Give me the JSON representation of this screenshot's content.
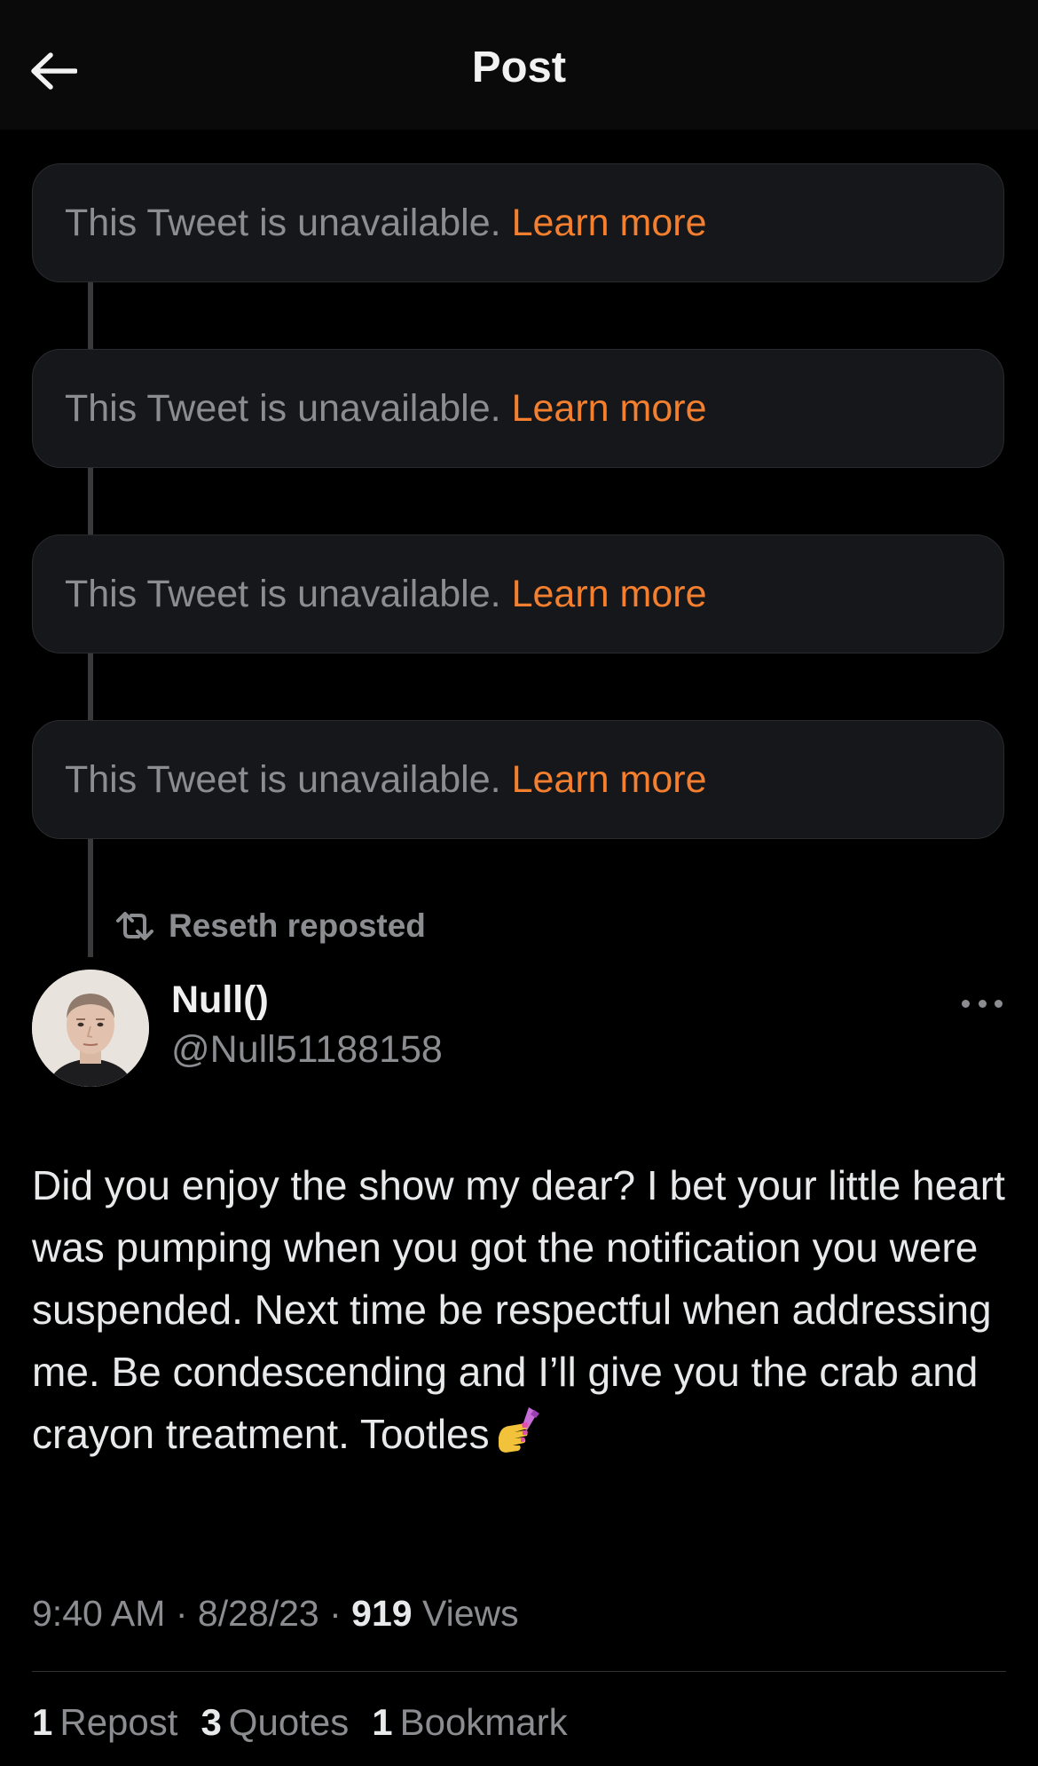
{
  "header": {
    "title": "Post",
    "back_icon": "arrow-left-icon"
  },
  "unavailable_tweets": [
    {
      "message": "This Tweet is unavailable.",
      "link": "Learn more"
    },
    {
      "message": "This Tweet is unavailable.",
      "link": "Learn more"
    },
    {
      "message": "This Tweet is unavailable.",
      "link": "Learn more"
    },
    {
      "message": "This Tweet is unavailable.",
      "link": "Learn more"
    }
  ],
  "repost_banner": {
    "icon": "repost-icon",
    "text": "Reseth reposted"
  },
  "tweet": {
    "author": {
      "display_name": "Null()",
      "handle": "@Null51188158"
    },
    "text": "Did you enjoy the show my dear? I bet your little heart was pumping when you got the notification you were suspended. Next time be respectful when addressing me. Be condescending and I’ll give you the crab and crayon treatment. Tootles",
    "emoji": "nail-polish-emoji",
    "time": "9:40 AM",
    "date": "8/28/23",
    "views_count": "919",
    "views_label": "Views",
    "stats": {
      "reposts_count": "1",
      "reposts_label": "Repost",
      "quotes_count": "3",
      "quotes_label": "Quotes",
      "bookmarks_count": "1",
      "bookmarks_label": "Bookmark"
    }
  },
  "colors": {
    "background": "#000000",
    "header_bg": "#0a0a0a",
    "card_bg": "#16171a",
    "link_accent": "#f4802f",
    "muted_text": "#8b8d91",
    "primary_text": "#e7e9ea"
  }
}
